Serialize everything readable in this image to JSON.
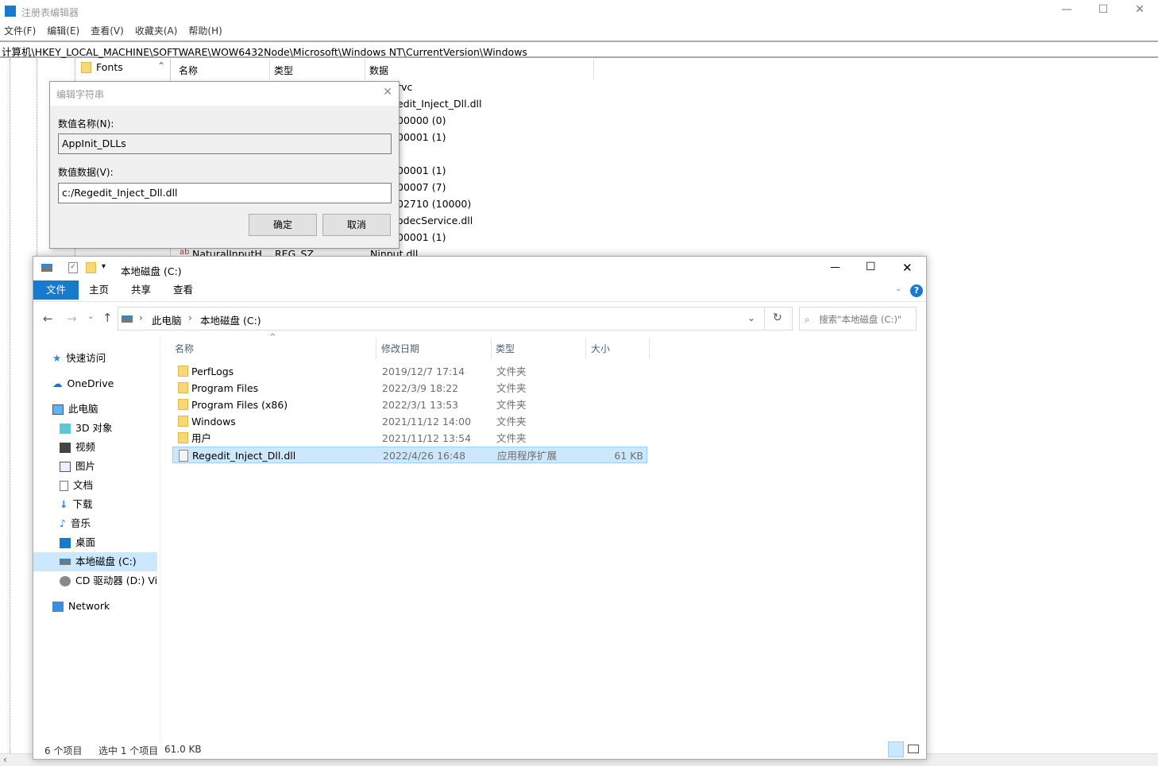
{
  "regedit": {
    "title": "注册表编辑器",
    "menu": [
      "文件(F)",
      "编辑(E)",
      "查看(V)",
      "收藏夹(A)",
      "帮助(H)"
    ],
    "address": "计算机\\HKEY_LOCAL_MACHINE\\SOFTWARE\\WOW6432Node\\Microsoft\\Windows NT\\CurrentVersion\\Windows",
    "tree_visible": "Fonts",
    "columns": [
      "名称",
      "类型",
      "数据"
    ],
    "values_data_visible": [
      "rvc",
      "edit_Inject_Dll.dll",
      "00000 (0)",
      "00001 (1)",
      "",
      "00001 (1)",
      "00007 (7)",
      "02710 (10000)",
      "odecService.dll",
      "00001 (1)"
    ],
    "last_row": {
      "name": "NaturalInputH",
      "type": "REG_SZ",
      "data": "Ninput.dll"
    }
  },
  "dialog": {
    "title": "编辑字符串",
    "name_label": "数值名称(N):",
    "name_value": "AppInit_DLLs",
    "data_label": "数值数据(V):",
    "data_value": "c:/Regedit_Inject_Dll.dll",
    "ok": "确定",
    "cancel": "取消"
  },
  "explorer": {
    "title": "本地磁盘 (C:)",
    "ribbon_tabs": [
      "文件",
      "主页",
      "共享",
      "查看"
    ],
    "breadcrumb": [
      "此电脑",
      "本地磁盘 (C:)"
    ],
    "search_placeholder": "搜索\"本地磁盘 (C:)\"",
    "nav": [
      {
        "label": "快速访问",
        "icon": "star-icon"
      },
      {
        "label": "OneDrive",
        "icon": "cloud-icon"
      },
      {
        "label": "此电脑",
        "icon": "computer-icon"
      },
      {
        "label": "3D 对象",
        "icon": "cube-icon"
      },
      {
        "label": "视频",
        "icon": "video-icon"
      },
      {
        "label": "图片",
        "icon": "picture-icon"
      },
      {
        "label": "文档",
        "icon": "document-icon"
      },
      {
        "label": "下载",
        "icon": "download-icon"
      },
      {
        "label": "音乐",
        "icon": "music-icon"
      },
      {
        "label": "桌面",
        "icon": "desktop-icon"
      },
      {
        "label": "本地磁盘 (C:)",
        "icon": "drive-icon"
      },
      {
        "label": "CD 驱动器 (D:) Vir",
        "icon": "cd-drive-icon"
      },
      {
        "label": "Network",
        "icon": "network-icon"
      }
    ],
    "columns": [
      "名称",
      "修改日期",
      "类型",
      "大小"
    ],
    "files": [
      {
        "name": "PerfLogs",
        "date": "2019/12/7 17:14",
        "type": "文件夹",
        "size": ""
      },
      {
        "name": "Program Files",
        "date": "2022/3/9 18:22",
        "type": "文件夹",
        "size": ""
      },
      {
        "name": "Program Files (x86)",
        "date": "2022/3/1 13:53",
        "type": "文件夹",
        "size": ""
      },
      {
        "name": "Windows",
        "date": "2021/11/12 14:00",
        "type": "文件夹",
        "size": ""
      },
      {
        "name": "用户",
        "date": "2021/11/12 13:54",
        "type": "文件夹",
        "size": ""
      },
      {
        "name": "Regedit_Inject_Dll.dll",
        "date": "2022/4/26 16:48",
        "type": "应用程序扩展",
        "size": "61 KB"
      }
    ],
    "status": {
      "count": "6 个项目",
      "selected": "选中 1 个项目",
      "size": "61.0 KB"
    },
    "accent": "#1979ca"
  }
}
